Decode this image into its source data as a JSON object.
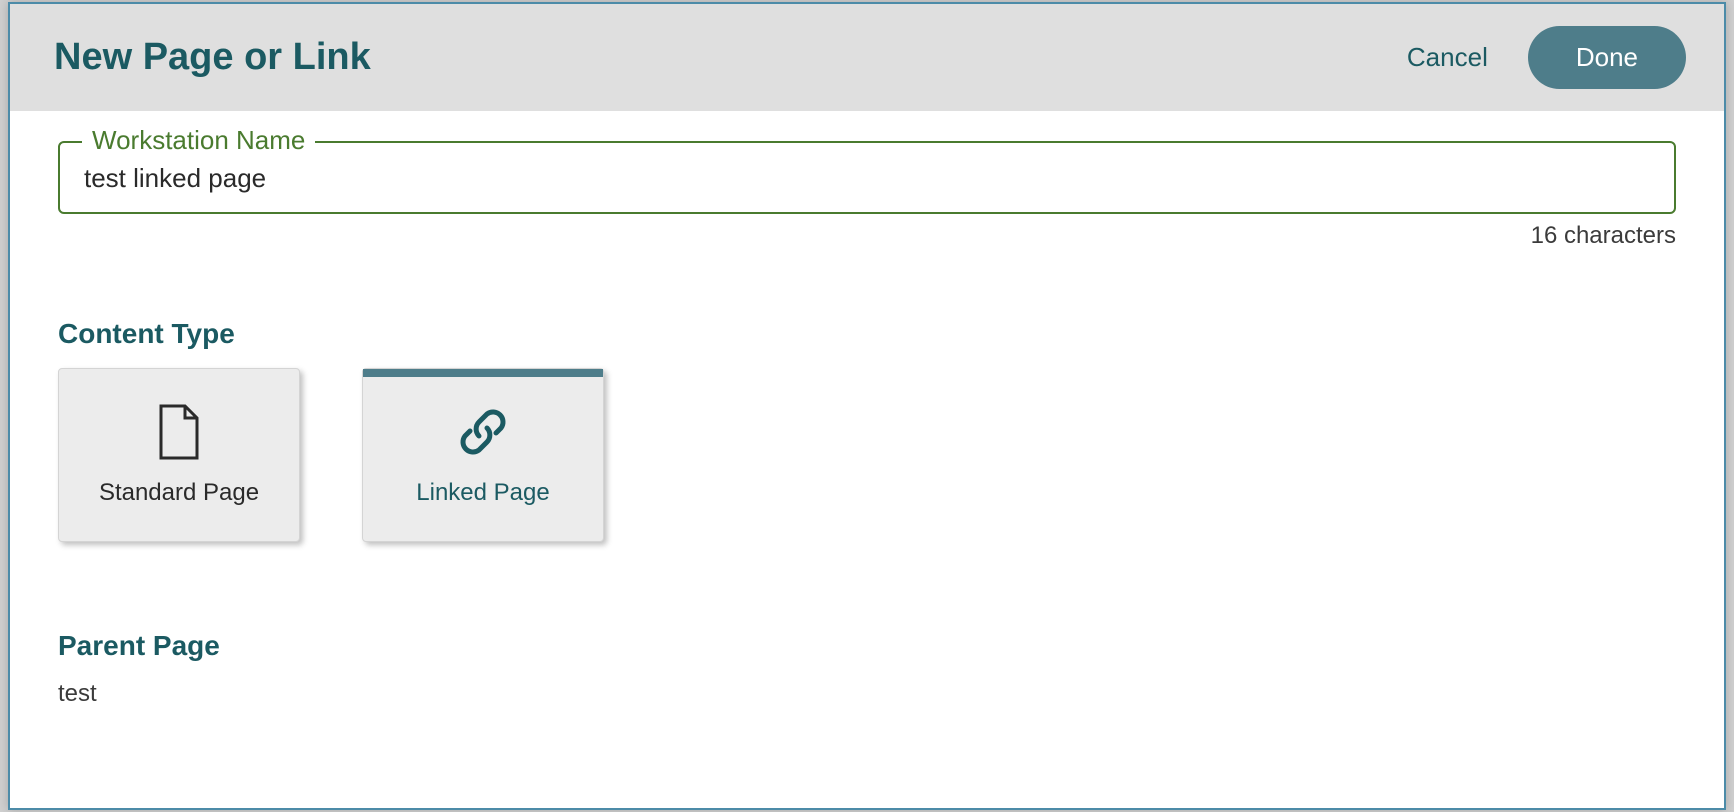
{
  "dialog": {
    "title": "New Page or Link",
    "cancel_label": "Cancel",
    "done_label": "Done"
  },
  "name_field": {
    "label": "Workstation Name",
    "value": "test linked page",
    "char_count_text": "16 characters"
  },
  "content_type": {
    "heading": "Content Type",
    "options": [
      {
        "label": "Standard Page",
        "icon": "file-icon",
        "selected": false
      },
      {
        "label": "Linked Page",
        "icon": "link-icon",
        "selected": true
      }
    ]
  },
  "parent_page": {
    "heading": "Parent Page",
    "value": "test"
  },
  "colors": {
    "brand_teal": "#1b5a62",
    "accent_teal": "#4e7d8a",
    "focus_green": "#4a7b2f",
    "panel_grey": "#ececec",
    "header_grey": "#dfdfdf"
  }
}
